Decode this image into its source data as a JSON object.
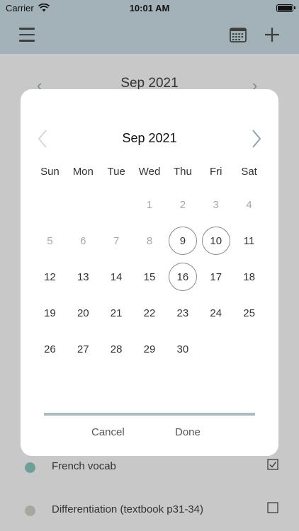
{
  "status_bar": {
    "carrier": "Carrier",
    "time": "10:01 AM"
  },
  "background": {
    "month_title": "Sep 2021",
    "tasks": [
      {
        "label": "French vocab",
        "checked": true,
        "dot_color": "#6ea09a",
        "check_glyph": "☑"
      },
      {
        "label": "Differentiation (textbook p31-34)",
        "checked": false,
        "dot_color": "#a7a79f",
        "check_glyph": "☐"
      }
    ]
  },
  "date_picker": {
    "month_title": "Sep 2021",
    "weekdays": [
      "Sun",
      "Mon",
      "Tue",
      "Wed",
      "Thu",
      "Fri",
      "Sat"
    ],
    "weeks": [
      [
        "",
        "",
        "",
        "1",
        "2",
        "3",
        "4"
      ],
      [
        "5",
        "6",
        "7",
        "8",
        "9",
        "10",
        "11"
      ],
      [
        "12",
        "13",
        "14",
        "15",
        "16",
        "17",
        "18"
      ],
      [
        "19",
        "20",
        "21",
        "22",
        "23",
        "24",
        "25"
      ],
      [
        "26",
        "27",
        "28",
        "29",
        "30",
        "",
        ""
      ]
    ],
    "muted_days": [
      "1",
      "2",
      "3",
      "4",
      "5",
      "6",
      "7",
      "8"
    ],
    "selected_days": [
      "9",
      "10",
      "16"
    ],
    "cancel_label": "Cancel",
    "done_label": "Done"
  },
  "colors": {
    "nav_bar": "#a3b1b8",
    "accent_bar": "#a9bcc4",
    "chevron": "#8fa5ae"
  }
}
